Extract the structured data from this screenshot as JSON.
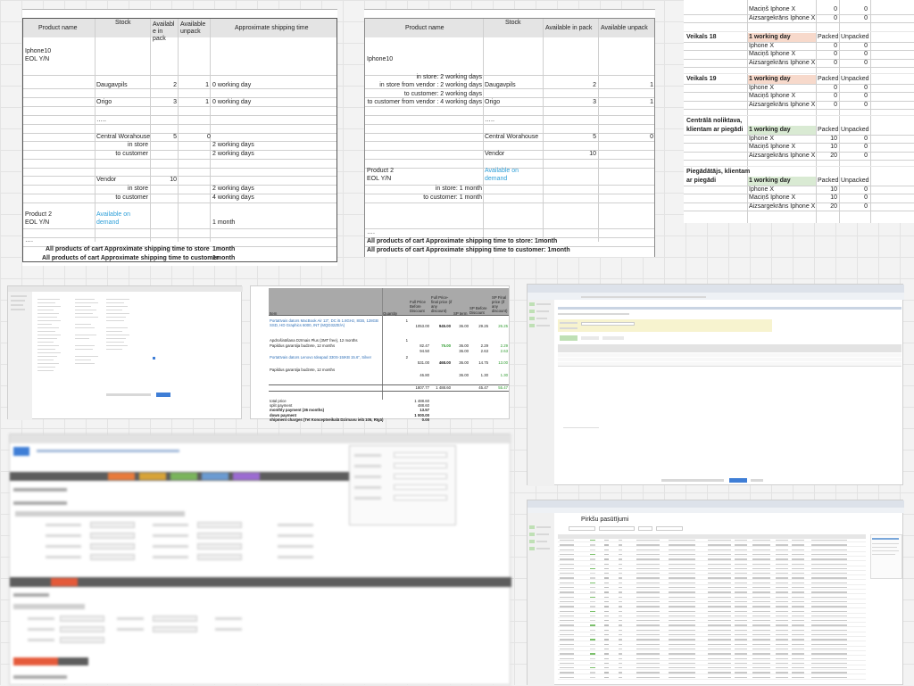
{
  "panel1": {
    "headers": {
      "product": "Product name",
      "stock": "Stock",
      "in_pack": "Availabl e in pack",
      "unpack": "Available unpack",
      "shipping": "Approximate shipping time"
    },
    "product1_line1": "Iphone10",
    "product1_line2": "EOL Y/N",
    "daugavpils": "Daugavpils",
    "daugavpils_pack": "2",
    "daugavpils_unpack": "1",
    "daugavpils_ship": "0 working day",
    "origo": "Origo",
    "origo_pack": "3",
    "origo_unpack": "1",
    "origo_ship": "0 working day",
    "dots": "…..",
    "central": "Central Worahouse",
    "central_pack": "5",
    "central_unpack": "0",
    "in_store": "in store",
    "in_store_ship": "2 working days",
    "to_customer": "to customer",
    "to_customer_ship": "2 working days",
    "vendor": "Vendor",
    "vendor_pack": "10",
    "vendor_in_store_ship": "2 working days",
    "vendor_to_customer_ship": "4 working days",
    "product2_line1": "Product  2",
    "product2_line2": "EOL Y/N",
    "available_on": "Available on",
    "demand": "demand",
    "product2_ship": "1 month",
    "dots2": "….",
    "total_store_label": "All  products of cart Approximate shipping time to store",
    "total_store_value": "1month",
    "total_customer_label": "All  products of cart Approximate shipping time to customer",
    "total_customer_value": "1month"
  },
  "panel2": {
    "headers": {
      "product": "Product name",
      "stock": "Stock",
      "in_pack": "Available in pack",
      "unpack": "Available unpack"
    },
    "product1": "Iphone10",
    "in_store": "in store: 2 working days",
    "in_store_from_vendor": "in store from vendor : 2 working days",
    "to_customer": "to customer: 2 working days",
    "to_customer_from_vendor": "to customer from vendor :    4 working days",
    "daugavpils": "Daugavpils",
    "daugavpils_pack": "2",
    "daugavpils_unpack": "1",
    "origo": "Origo",
    "origo_pack": "3",
    "origo_unpack": "1",
    "dots": "…..",
    "central": "Central Worahouse",
    "central_pack": "5",
    "central_unpack": "0",
    "vendor": "Vendor",
    "vendor_pack": "10",
    "product2_line1": "Product  2",
    "product2_line2": "EOL Y/N",
    "available_on": "Available on",
    "demand": "demand",
    "p2_in_store": "in store: 1 month",
    "p2_to_customer": "to customer: 1 month",
    "dots2": "….",
    "total_store": "All  products of cart Approximate shipping time to store:  1month",
    "total_customer": "All  products of cart Approximate shipping time to customer: 1month"
  },
  "panel3": {
    "top_rows": [
      {
        "name": "Maciņš Iphone X",
        "a": "0",
        "b": "0"
      },
      {
        "name": "Aizsargekrāns Iphone X",
        "a": "0",
        "b": "0"
      }
    ],
    "groups": [
      {
        "store": "Veikals 18",
        "store2": "",
        "day": "1 working day",
        "packed": "Packed",
        "unpacked": "Unpacked",
        "shade": "peach",
        "rows": [
          {
            "name": "Iphone X",
            "a": "0",
            "b": "0"
          },
          {
            "name": "Maciņš Iphone X",
            "a": "0",
            "b": "0"
          },
          {
            "name": "Aizsargekrāns Iphone X",
            "a": "0",
            "b": "0"
          }
        ]
      },
      {
        "store": "Veikals 19",
        "store2": "",
        "day": "1 working day",
        "packed": "Packed",
        "unpacked": "Unpacked",
        "shade": "peach",
        "rows": [
          {
            "name": "Iphone X",
            "a": "0",
            "b": "0"
          },
          {
            "name": "Maciņš Iphone X",
            "a": "0",
            "b": "0"
          },
          {
            "name": "Aizsargekrāns Iphone X",
            "a": "0",
            "b": "0"
          }
        ]
      },
      {
        "store": "Centrālā noliktava,",
        "store2": "klientam ar piegādi",
        "day": "1 working day",
        "packed": "Packed",
        "unpacked": "Unpacked",
        "shade": "green",
        "rows": [
          {
            "name": "Iphone X",
            "a": "10",
            "b": "0"
          },
          {
            "name": "Maciņš Iphone X",
            "a": "10",
            "b": "0"
          },
          {
            "name": "Aizsargekrāns Iphone X",
            "a": "20",
            "b": "0"
          }
        ]
      },
      {
        "store": "Piegādātājs, klientam",
        "store2": "ar piegādi",
        "day": "1 working day",
        "packed": "Packed",
        "unpacked": "Unpacked",
        "shade": "green",
        "rows": [
          {
            "name": "Iphone X",
            "a": "10",
            "b": "0"
          },
          {
            "name": "Maciņš Iphone X",
            "a": "10",
            "b": "0"
          },
          {
            "name": "Aizsargekrāns Iphone X",
            "a": "20",
            "b": "0"
          }
        ]
      }
    ]
  },
  "quote": {
    "headers": {
      "item": "Item",
      "quantity": "Quantity",
      "full_before": "Full Price Before Discount",
      "full_after": "Full Price- final price (if any discount)",
      "sp_term": "SP term",
      "sp_before": "SP Before Discount",
      "sp_final": "SP Final price (if any discount)"
    },
    "rows": [
      {
        "item": "Portatīvais dators MacBook Air 13\", DC i5 1.8GHz, 8GB, 128GB SSD, HD Graphics 6000, INT (MQD32ZE/A)",
        "qty": "1",
        "before": "1053.00",
        "after": "945.00",
        "term": "36.00",
        "spb": "29.25",
        "spf": "26.25",
        "link": true,
        "green": false
      },
      {
        "item": "Apdrošināšana Dzīmais Plus (3MT free), 12 months",
        "qty": "1",
        "before": "82.47",
        "after": "75.00",
        "term": "36.00",
        "spb": "2.29",
        "spf": "2.29",
        "link": false,
        "green": true
      },
      {
        "item": "Papildus garantija budzete, 12 months",
        "qty": "",
        "before": "94.50",
        "after": "",
        "term": "36.00",
        "spb": "2.63",
        "spf": "2.63",
        "link": false,
        "green": false
      },
      {
        "item": "Portatīvais dators Lenovo Ideapad 330S-15IKB 15.6\", Silver",
        "qty": "2",
        "before": "531.00",
        "after": "468.00",
        "term": "36.00",
        "spb": "14.75",
        "spf": "13.00",
        "link": true,
        "green": false
      },
      {
        "item": "Papildus garantija budzete, 12 months",
        "qty": "",
        "before": "46.80",
        "after": "",
        "term": "36.00",
        "spb": "1.30",
        "spf": "1.30",
        "link": false,
        "green": false
      }
    ],
    "totals_row": {
      "before": "1807.77",
      "after": "1 488.60",
      "spb": "45.47",
      "spf": "55.47"
    },
    "summary": [
      {
        "label": "total price",
        "value": "1 488.60",
        "bold": false
      },
      {
        "label": "split payment",
        "value": "488.60",
        "bold": false
      },
      {
        "label": "monthly payment (36 months)",
        "value": "13.57",
        "bold": true
      },
      {
        "label": "down payment",
        "value": "1 000.00",
        "bold": true
      },
      {
        "label": "shipment charges (Tet Konceptveikalā Dzirnavu ielā 105, Rīgā)",
        "value": "0.00",
        "bold": true
      }
    ]
  },
  "orders": {
    "title": "Pirkšu pasūtījumi"
  }
}
